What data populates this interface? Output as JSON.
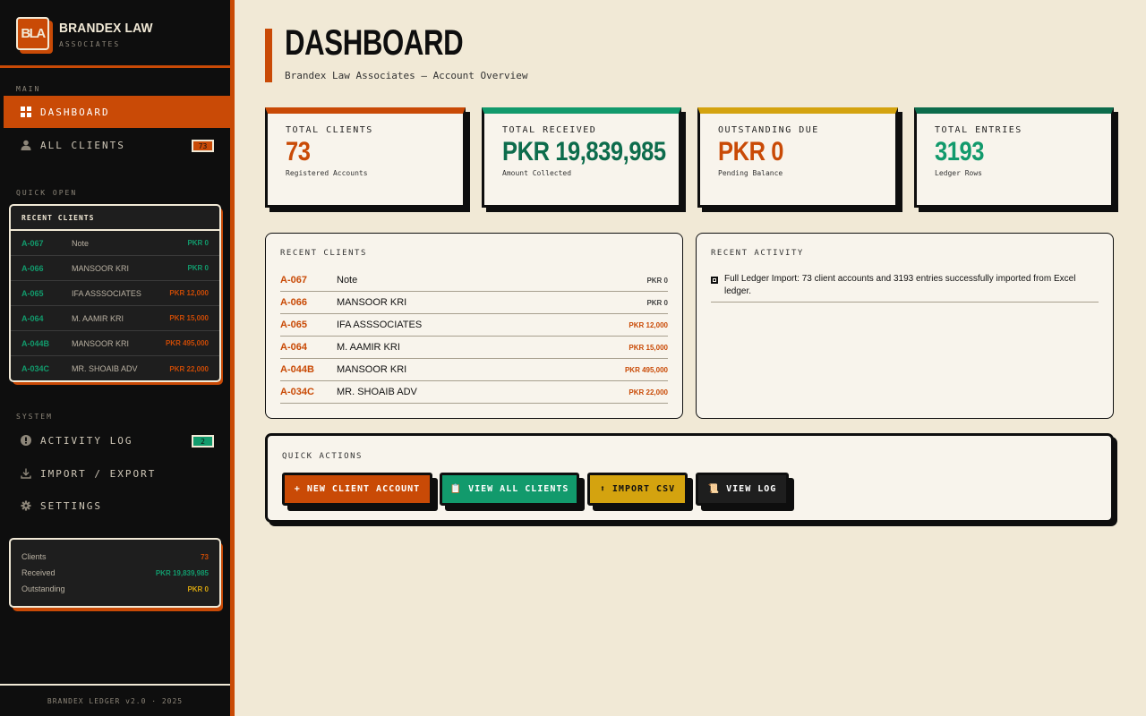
{
  "brand": {
    "logo": "BLA",
    "name": "BRANDEX LAW",
    "subtitle": "ASSOCIATES"
  },
  "sidebar": {
    "main_label": "MAIN",
    "nav": [
      {
        "label": "DASHBOARD",
        "icon": "grid-icon",
        "active": true
      },
      {
        "label": "ALL CLIENTS",
        "icon": "user-icon",
        "badge": "73"
      }
    ],
    "quick_open_label": "QUICK OPEN",
    "recent_title": "RECENT CLIENTS",
    "recent": [
      {
        "id": "A-067",
        "name": "Note",
        "amount": "PKR 0"
      },
      {
        "id": "A-066",
        "name": "MANSOOR KRI",
        "amount": "PKR 0"
      },
      {
        "id": "A-065",
        "name": "IFA ASSSOCIATES",
        "amount": "PKR 12,000"
      },
      {
        "id": "A-064",
        "name": "M. AAMIR KRI",
        "amount": "PKR 15,000"
      },
      {
        "id": "A-044B",
        "name": "MANSOOR KRI",
        "amount": "PKR 495,000"
      },
      {
        "id": "A-034C",
        "name": "MR. SHOAIB ADV",
        "amount": "PKR 22,000"
      }
    ],
    "system_label": "SYSTEM",
    "system_nav": [
      {
        "label": "ACTIVITY LOG",
        "icon": "info-icon",
        "badge": "2"
      },
      {
        "label": "IMPORT / EXPORT",
        "icon": "download-icon"
      },
      {
        "label": "SETTINGS",
        "icon": "gear-icon"
      }
    ],
    "stats": [
      {
        "label": "Clients",
        "value": "73",
        "color": "#c94a06"
      },
      {
        "label": "Received",
        "value": "PKR 19,839,985",
        "color": "#129a6c"
      },
      {
        "label": "Outstanding",
        "value": "PKR 0",
        "color": "#d4a30f"
      }
    ],
    "footer": "BRANDEX LEDGER v2.0 · 2025"
  },
  "header": {
    "title": "DASHBOARD",
    "subtitle": "Brandex Law Associates — Account Overview"
  },
  "cards": [
    {
      "label": "TOTAL CLIENTS",
      "value": "73",
      "sub": "Registered Accounts",
      "accent": "#c94a06",
      "value_color": "#c94a06"
    },
    {
      "label": "TOTAL RECEIVED",
      "value": "PKR 19,839,985",
      "sub": "Amount Collected",
      "accent": "#129a6c",
      "value_color": "#0d6c4c"
    },
    {
      "label": "OUTSTANDING DUE",
      "value": "PKR 0",
      "sub": "Pending Balance",
      "accent": "#d4a30f",
      "value_color": "#c94a06"
    },
    {
      "label": "TOTAL ENTRIES",
      "value": "3193",
      "sub": "Ledger Rows",
      "accent": "#0d6c4c",
      "value_color": "#129a6c"
    }
  ],
  "recent_clients": {
    "label": "RECENT CLIENTS",
    "rows": [
      {
        "id": "A-067",
        "name": "Note",
        "amount": "PKR 0"
      },
      {
        "id": "A-066",
        "name": "MANSOOR KRI",
        "amount": "PKR 0"
      },
      {
        "id": "A-065",
        "name": "IFA ASSSOCIATES",
        "amount": "PKR 12,000"
      },
      {
        "id": "A-064",
        "name": "M. AAMIR KRI",
        "amount": "PKR 15,000"
      },
      {
        "id": "A-044B",
        "name": "MANSOOR KRI",
        "amount": "PKR 495,000"
      },
      {
        "id": "A-034C",
        "name": "MR. SHOAIB ADV",
        "amount": "PKR 22,000"
      }
    ]
  },
  "recent_activity": {
    "label": "RECENT ACTIVITY",
    "items": [
      {
        "text": "Full Ledger Import: 73 client accounts and 3193 entries successfully imported from Excel ledger."
      }
    ]
  },
  "quick_actions": {
    "label": "QUICK ACTIONS",
    "buttons": [
      {
        "label": "+ NEW CLIENT ACCOUNT",
        "bg": "#c94a06",
        "fg": "#ffffff"
      },
      {
        "label": "📋 VIEW ALL CLIENTS",
        "bg": "#129a6c",
        "fg": "#ffffff"
      },
      {
        "label": "⬆ IMPORT CSV",
        "bg": "#d4a30f",
        "fg": "#111111"
      },
      {
        "label": "📜 VIEW LOG",
        "bg": "#1e1e1e",
        "fg": "#ffffff"
      }
    ]
  }
}
